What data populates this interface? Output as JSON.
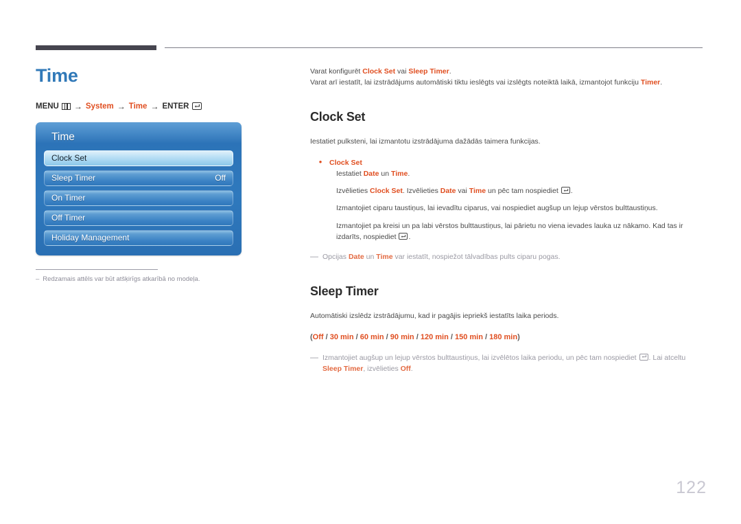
{
  "document": {
    "page_number": "122"
  },
  "left": {
    "page_title": "Time",
    "breadcrumb": {
      "menu_label": "MENU",
      "menu_icon": "menu-grid-icon",
      "arrow": "→",
      "step_system": "System",
      "step_time": "Time",
      "enter_label": "ENTER",
      "enter_icon": "enter-key-icon"
    },
    "osd": {
      "title": "Time",
      "rows": [
        {
          "label": "Clock Set",
          "value": "",
          "selected": true
        },
        {
          "label": "Sleep Timer",
          "value": "Off",
          "selected": false
        },
        {
          "label": "On Timer",
          "value": "",
          "selected": false
        },
        {
          "label": "Off Timer",
          "value": "",
          "selected": false
        },
        {
          "label": "Holiday Management",
          "value": "",
          "selected": false
        }
      ]
    },
    "panel_note": {
      "dash": "–",
      "text": "Redzamais attēls var būt atšķirīgs atkarībā no modeļa."
    }
  },
  "right": {
    "intro": {
      "line1_a": "Varat konfigurēt ",
      "line1_b": "Clock Set",
      "line1_c": " vai ",
      "line1_d": "Sleep Timer",
      "line1_e": ".",
      "line2_a": "Varat arī iestatīt, lai izstrādājums automātiski tiktu ieslēgts vai izslēgts noteiktā laikā, izmantojot funkciju ",
      "line2_b": "Timer",
      "line2_c": "."
    },
    "clock_set": {
      "heading": "Clock Set",
      "lead": "Iestatiet pulksteni, lai izmantotu izstrādājuma dažādās taimera funkcijas.",
      "bullet_title": "Clock Set",
      "b1_a": "Iestatiet ",
      "b1_b": "Date",
      "b1_c": " un ",
      "b1_d": "Time",
      "b1_e": ".",
      "b2_a": "Izvēlieties ",
      "b2_b": "Clock Set",
      "b2_c": ". Izvēlieties ",
      "b2_d": "Date",
      "b2_e": " vai ",
      "b2_f": "Time",
      "b2_g": " un pēc tam nospiediet ",
      "b2_h": ".",
      "b3": "Izmantojiet ciparu taustiņus, lai ievadītu ciparus, vai nospiediet augšup un lejup vērstos bulttaustiņus.",
      "b4_a": "Izmantojiet pa kreisi un pa labi vērstos bulttaustiņus, lai pārietu no viena ievades lauka uz nākamo. Kad tas ir izdarīts, nospiediet ",
      "b4_b": ".",
      "note_dash": "―",
      "note_a": "Opcijas ",
      "note_b": "Date",
      "note_c": " un ",
      "note_d": "Time",
      "note_e": " var iestatīt, nospiežot tālvadības pults ciparu pogas."
    },
    "sleep_timer": {
      "heading": "Sleep Timer",
      "lead": "Automātiski izslēdz izstrādājumu, kad ir pagājis iepriekš iestatīts laika periods.",
      "options_open": "(",
      "options": [
        "Off",
        "30 min",
        "60 min",
        "90 min",
        "120 min",
        "150 min",
        "180 min"
      ],
      "options_sep": " / ",
      "options_close": ")",
      "note_dash": "―",
      "note_a": "Izmantojiet augšup un lejup vērstos bulttaustiņus, lai izvēlētos laika periodu, un pēc tam nospiediet ",
      "note_b": ". Lai atceltu ",
      "note_c": "Sleep Timer",
      "note_d": ", izvēlieties ",
      "note_e": "Off",
      "note_f": "."
    }
  },
  "colors": {
    "accent_orange": "#e04e20",
    "title_blue": "#3179b8",
    "osd_blue": "#2f79bd",
    "page_num_gray": "#c9c8d2"
  }
}
